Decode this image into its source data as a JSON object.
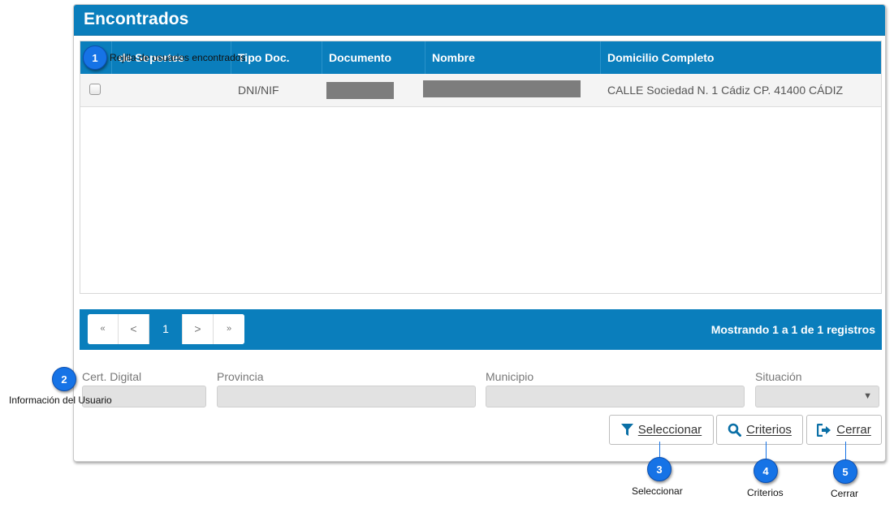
{
  "panel": {
    "title": "Encontrados"
  },
  "table": {
    "columns": [
      "Tipo Doc.",
      "Documento",
      "Nombre",
      "Domicilio Completo"
    ],
    "hidden_header": "de Soportes",
    "rows": [
      {
        "tipo_doc": "DNI/NIF",
        "documento": "",
        "nombre": "",
        "domicilio": "CALLE Sociedad N. 1 Cádiz CP. 41400 CÁDIZ"
      }
    ]
  },
  "pagination": {
    "first": "«",
    "prev": "<",
    "current": "1",
    "next": ">",
    "last": "»",
    "info": "Mostrando 1 a 1 de 1 registros"
  },
  "form": {
    "cert_label": "Cert. Digital",
    "provincia_label": "Provincia",
    "municipio_label": "Municipio",
    "situacion_label": "Situación",
    "cert_value": "",
    "provincia_value": "",
    "municipio_value": "",
    "situacion_value": ""
  },
  "buttons": {
    "seleccionar": "Seleccionar",
    "criterios": "Criterios",
    "cerrar": "Cerrar"
  },
  "callouts": [
    {
      "number": "1",
      "text": "Rejilla de usuarios encontrados"
    },
    {
      "number": "2",
      "text": "Información del Usuario"
    },
    {
      "number": "3",
      "text": "Seleccionar"
    },
    {
      "number": "4",
      "text": "Criterios"
    },
    {
      "number": "5",
      "text": "Cerrar"
    }
  ],
  "colors": {
    "header_blue": "#0a7ebc",
    "callout_blue": "#1673e6"
  }
}
